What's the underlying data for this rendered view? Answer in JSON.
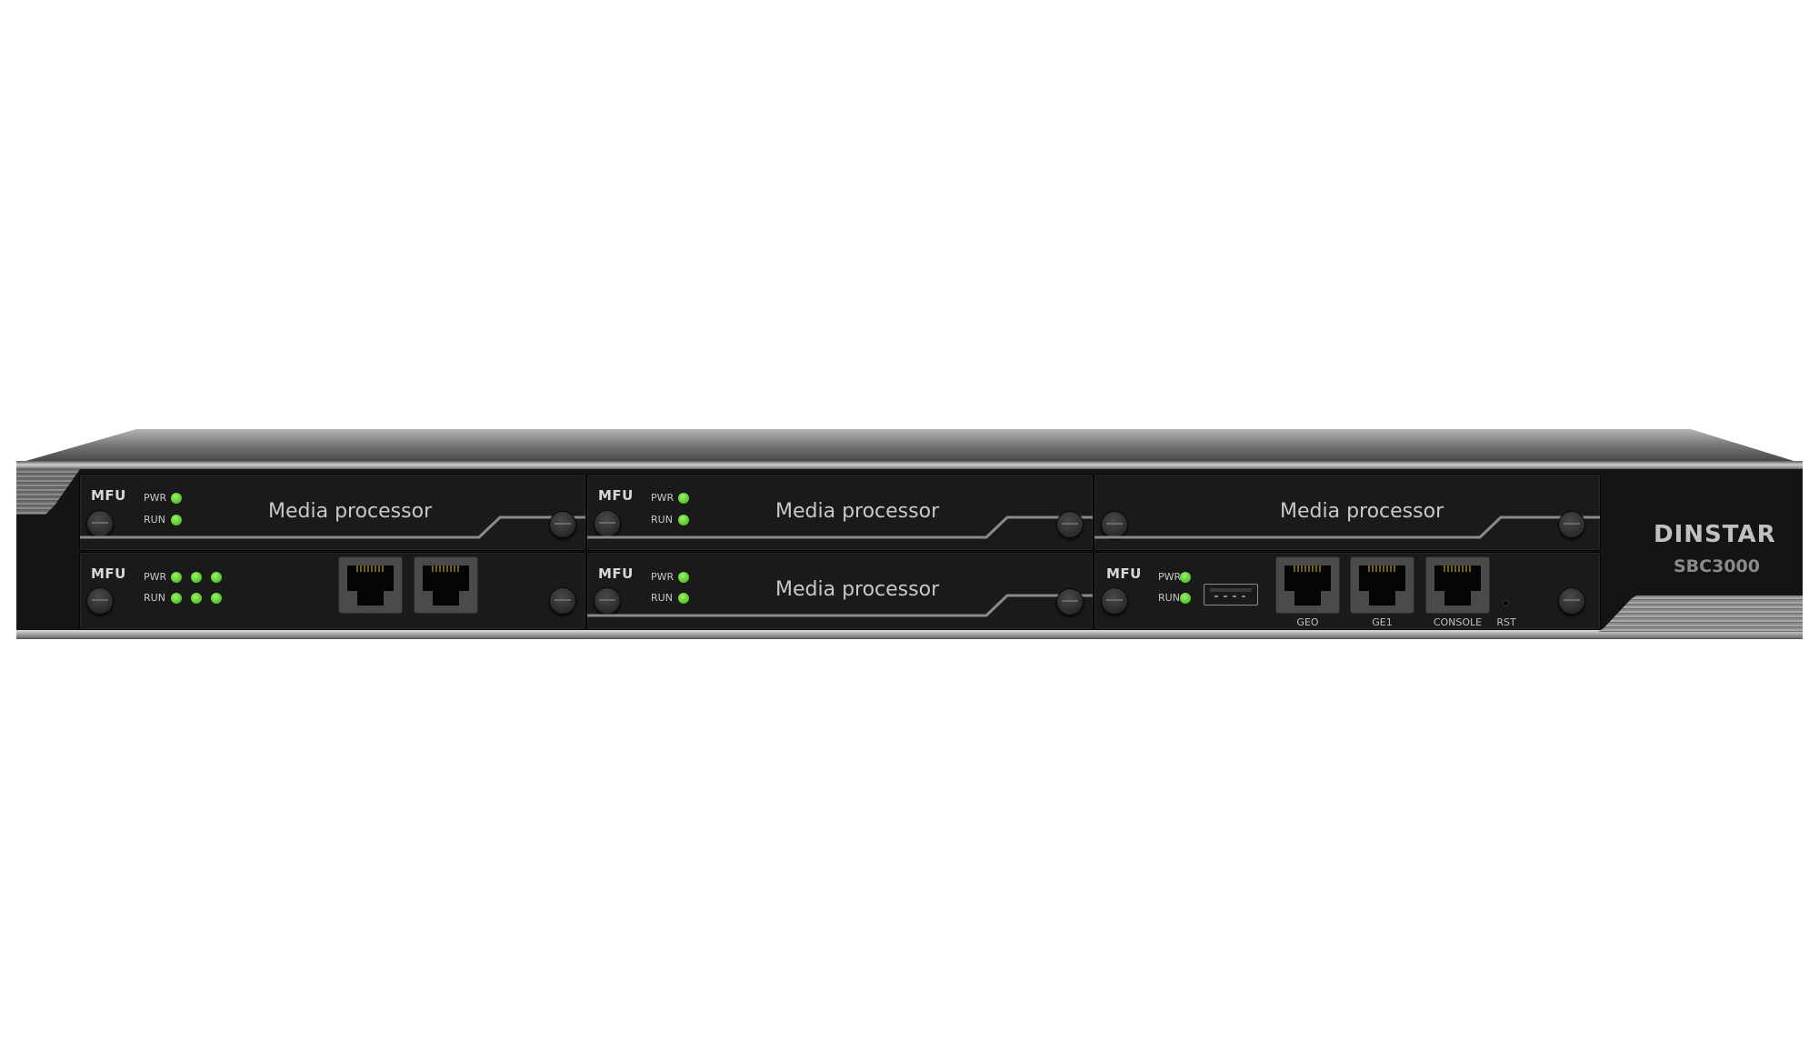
{
  "device": {
    "brand": "DINSTAR",
    "model": "SBC3000",
    "colors": {
      "led_green": "#5ccc30",
      "chassis": "#141414",
      "text": "#c8c8c8"
    }
  },
  "slots": {
    "top_left": {
      "title": "Media processor",
      "mfu": "MFU",
      "leds": [
        {
          "label": "PWR",
          "count": 1,
          "state": "on"
        },
        {
          "label": "RUN",
          "count": 1,
          "state": "on"
        }
      ]
    },
    "top_middle": {
      "title": "Media processor",
      "mfu": "MFU",
      "leds": [
        {
          "label": "PWR",
          "count": 1,
          "state": "on"
        },
        {
          "label": "RUN",
          "count": 1,
          "state": "on"
        }
      ]
    },
    "top_right": {
      "title": "Media processor"
    },
    "bottom_left": {
      "mfu": "MFU",
      "leds": [
        {
          "label": "PWR",
          "count": 3,
          "state": "on"
        },
        {
          "label": "RUN",
          "count": 3,
          "state": "on"
        }
      ],
      "ports": [
        "rj45",
        "rj45"
      ]
    },
    "bottom_middle": {
      "title": "Media processor",
      "mfu": "MFU",
      "leds": [
        {
          "label": "PWR",
          "count": 1,
          "state": "on"
        },
        {
          "label": "RUN",
          "count": 1,
          "state": "on"
        }
      ]
    },
    "bottom_right": {
      "mfu": "MFU",
      "leds": [
        {
          "label": "PWR",
          "count": 1,
          "state": "on"
        },
        {
          "label": "RUN",
          "count": 1,
          "state": "on"
        }
      ],
      "usb": "usb-port",
      "ports": [
        {
          "label": "GEO"
        },
        {
          "label": "GE1"
        },
        {
          "label": "CONSOLE"
        }
      ],
      "reset_label": "RST"
    }
  }
}
